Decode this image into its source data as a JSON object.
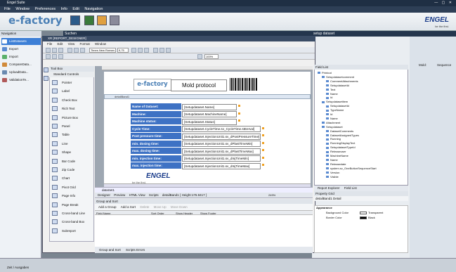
{
  "app": {
    "title": "Engel Suite"
  },
  "menubar": [
    "File",
    "Window",
    "Preferences",
    "Info",
    "Edit",
    "Navigation"
  ],
  "brand": {
    "name": "e-factory",
    "logo": "ENGEL",
    "tagline": "be the first."
  },
  "nav": {
    "header": "Navigation",
    "items": [
      "ListDatasets",
      "Export",
      "Import",
      "CompareData...",
      "UploadData...",
      "ValidationTe..."
    ]
  },
  "panes": {
    "search": "Suchen",
    "setup": "setup dataset"
  },
  "designer": {
    "title": "XR [REPORT_DESIGNER]",
    "menu": [
      "File",
      "Edit",
      "View",
      "Format",
      "Window"
    ],
    "font": "Times New Roman",
    "size": "9,75",
    "zoom": "100%",
    "toolbox": {
      "header": "Tool Box",
      "section": "Standard Controls",
      "items": [
        "Pointer",
        "Label",
        "Check Box",
        "Rich Text",
        "Picture Box",
        "Panel",
        "Table",
        "Line",
        "Shape",
        "Bar Code",
        "Zip Code",
        "Chart",
        "Pivot Grid",
        "Page Info",
        "Page Break",
        "Cross-band Line",
        "Cross-band Box",
        "Subreport"
      ]
    },
    "band": "detailBand1",
    "report": {
      "logo": "e-factory",
      "heading": "Mold protocol",
      "engel": "ENGEL",
      "engel_tag": "be the first.",
      "rows": [
        {
          "label": "Name of Dataset:",
          "value": "[Setupdataset.Name]"
        },
        {
          "label": "Machine:",
          "value": "[Setupdataset.MachineName]"
        },
        {
          "label": "Machine status:",
          "value": "[Setupdataset.Status]"
        },
        {
          "label": "Cycle Time:",
          "value": "[Setupdataset.CycleTime.sv_CycleTime.stEerval]"
        },
        {
          "label": "Post pressure time:",
          "value": "[Setupdataset.InjectionUnit1.sv_dPostPressureTime]"
        },
        {
          "label": "min. dosing time:",
          "value": "[Setupdataset.InjectionUnit1.sv_dPlastTimeMin]"
        },
        {
          "label": "max. dosing time:",
          "value": "[Setupdataset.InjectionUnit1.sv_dPlastTimeMax]"
        },
        {
          "label": "min. injection time:",
          "value": "[Setupdataset.InjectionUnit1.sv_dInjTimeMin]"
        },
        {
          "label": "max. injection time:",
          "value": "[Setupdataset.InjectionUnit1.sv_dInjTimeMax]"
        }
      ]
    },
    "dataset_tab": "dataSet1",
    "bottom_bar": [
      "Designer",
      "Preview",
      "HTML View",
      "Scripts",
      "detailBand1 { Height:176.9417 }"
    ],
    "zoom_pct": "249%"
  },
  "group_sort": {
    "header": "Group and Sort",
    "actions": [
      "Add a Group",
      "Add a Sort",
      "Delete",
      "Move Up",
      "Move Down"
    ],
    "columns": [
      "Field Name",
      "Sort Order",
      "Show Header",
      "Show Footer"
    ],
    "tabs": [
      "Group and Sort",
      "Scripts Errors"
    ]
  },
  "field_list": {
    "header": "Field List",
    "tree": [
      "Printout",
      "Setupdatasetcomment",
      "CommentAttachments",
      "SetupdatasetId",
      "Text",
      "Name",
      "Id",
      "Setupdatasetitem",
      "SetupdatasetId",
      "TypeName",
      "Id",
      "Name",
      "Attachment",
      "Setupdataset",
      "DatasetComments",
      "DatasetAssignedTypes",
      "Running",
      "RunningDisplayText",
      "SetupdatasetTypeId",
      "Releaseuser",
      "MachineName",
      "Name",
      "Releasedate",
      "system.sv_OneButtonSequenceStart",
      "Version",
      "Visible"
    ],
    "tabs": [
      "Report Explorer",
      "Field List"
    ]
  },
  "property_grid": {
    "header": "Property Grid",
    "subject": "detailBand1  Detail",
    "section": "Appearance",
    "rows": [
      {
        "key": "Background Color",
        "value": "Transparent"
      },
      {
        "key": "Border Color",
        "value": "Black"
      }
    ]
  },
  "right_panel": {
    "labels": [
      "Mold:",
      "Sequence"
    ]
  },
  "status": {
    "text": "Zeit / Ausgaben"
  },
  "colors": {
    "accent": "#3e72c4",
    "brand": "#4a7fb5",
    "title": "#1f2f44"
  }
}
